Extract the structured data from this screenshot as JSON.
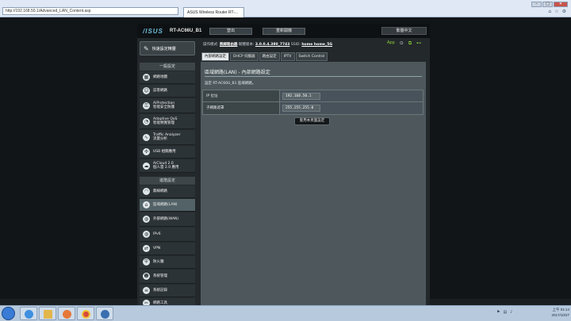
{
  "browser": {
    "address": "http://192.168.50.1/Advanced_LAN_Content.asp",
    "tab_title": "ASUS Wireless Router RT-...",
    "window_controls": [
      "–",
      "□",
      "✕"
    ],
    "toolbar_icons": [
      "home-icon",
      "star-icon",
      "gear-icon"
    ]
  },
  "header": {
    "logo": "/ISUS",
    "model": "RT-AC66U_B1",
    "logout": "登出",
    "reboot": "重新開機",
    "language": "繁體中文"
  },
  "status": {
    "mode_label": "操作模式:",
    "mode_value": "無線路由器",
    "fw_label": "韌體版本:",
    "fw_value": "3.0.0.4.380_7743",
    "ssid_label": "SSID:",
    "ssid_value": "home  home_5G",
    "app_label": "App"
  },
  "sidebar": {
    "quick": "快速設定精靈",
    "general_title": "一般設定",
    "general": [
      {
        "label": "網路地圖",
        "icon": "network-map-icon"
      },
      {
        "label": "訪客網路",
        "icon": "guest-network-icon"
      },
      {
        "label": "AiProtection\n智能安全防護",
        "icon": "aiprotection-icon"
      },
      {
        "label": "Adaptive QoS\n智能頻寬管理",
        "icon": "qos-icon"
      },
      {
        "label": "Traffic Analyzer\n流量分析",
        "icon": "traffic-analyzer-icon"
      },
      {
        "label": "USB 相關應用",
        "icon": "usb-icon"
      },
      {
        "label": "AiCloud 2.0\n個人雲 2.0 應用",
        "icon": "aicloud-icon"
      }
    ],
    "advanced_title": "進階設定",
    "advanced": [
      {
        "label": "無線網路",
        "icon": "wireless-icon"
      },
      {
        "label": "區域網路(LAN)",
        "icon": "lan-icon",
        "active": true
      },
      {
        "label": "外部網路(WAN)",
        "icon": "wan-icon"
      },
      {
        "label": "IPv6",
        "icon": "ipv6-icon"
      },
      {
        "label": "VPN",
        "icon": "vpn-icon"
      },
      {
        "label": "防火牆",
        "icon": "firewall-icon"
      },
      {
        "label": "系統管理",
        "icon": "administration-icon"
      },
      {
        "label": "系統記錄",
        "icon": "system-log-icon"
      },
      {
        "label": "網路工具",
        "icon": "network-tools-icon"
      }
    ]
  },
  "tabs": [
    "內部網路設定",
    "DHCP 伺服器",
    "路由設定",
    "IPTV",
    "Switch Control"
  ],
  "content": {
    "title": "區域網路(LAN) - 內部網路設定",
    "description": "設定 RT-AC66U_B1 區域網路。",
    "fields": [
      {
        "label": "IP 位址",
        "value": "192.168.50.1"
      },
      {
        "label": "子網路遮罩",
        "value": "255.255.255.0"
      }
    ],
    "apply": "套用本頁面設定"
  },
  "taskbar": {
    "time": "上午 01:14",
    "date": "2017/10/27",
    "apps": [
      "start-orb",
      "ie-icon",
      "explorer-icon",
      "media-icon",
      "chrome-icon",
      "app-icon"
    ]
  }
}
